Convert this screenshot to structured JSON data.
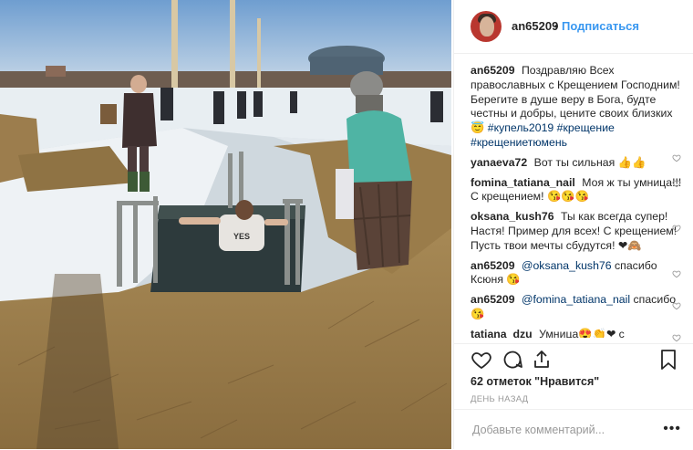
{
  "post": {
    "username": "an65209",
    "separator": "•",
    "follow_label": "Подписаться",
    "caption": {
      "user": "an65209",
      "text": "Поздравляю Всех православных с Крещением Господним! Берегите в душе веру в Бога, будте честны и добры, цените своих близких 😇",
      "tags": "#купель2019 #крещение #крещениетюмень"
    },
    "comments": [
      {
        "user": "yanaeva72",
        "text": "Вот ты сильная 👍👍"
      },
      {
        "user": "fomina_tatiana_nail",
        "text": "Моя ж ты умница!!! С крещением! 😘😘😘"
      },
      {
        "user": "oksana_kush76",
        "text": "Ты как всегда супер! Настя! Пример для всех! С крещением! Пусть твои мечты сбудутся! ❤🙈"
      },
      {
        "user": "an65209",
        "mention": "@oksana_kush76",
        "text": "спасибо Ксюня 😘"
      },
      {
        "user": "an65209",
        "mention": "@fomina_tatiana_nail",
        "text": "спасибо 😘"
      },
      {
        "user": "tatiana_dzu",
        "text": "Умница😍👏❤ с"
      }
    ],
    "likes": "62 отметок \"Нравится\"",
    "date": "ДЕНЬ НАЗАД",
    "comment_placeholder": "Добавьте комментарий...",
    "more": "•••"
  }
}
